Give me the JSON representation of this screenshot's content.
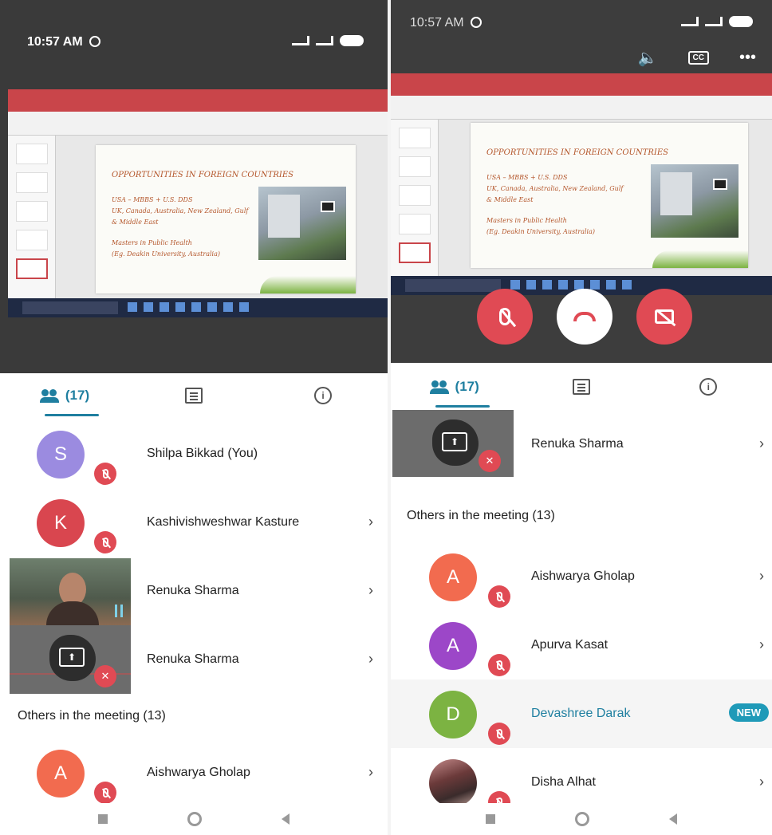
{
  "left": {
    "status": {
      "time": "10:57 AM"
    },
    "slide": {
      "title": "OPPORTUNITIES IN FOREIGN COUNTRIES",
      "lines": [
        "USA – MBBS + U.S. DDS",
        "UK, Canada, Australia, New Zealand, Gulf",
        "& Middle East",
        "Masters in Public Health",
        "(Eg. Deakin University, Australia)"
      ]
    },
    "tabs": {
      "people_count": "(17)"
    },
    "participants": [
      {
        "initial": "S",
        "name": "Shilpa Bikkad (You)",
        "color": "#9b8be0"
      },
      {
        "initial": "K",
        "name": "Kashivishweshwar Kasture",
        "color": "#d9464f"
      },
      {
        "name": "Renuka Sharma"
      },
      {
        "name": "Renuka Sharma"
      }
    ],
    "others_label": "Others in the meeting (13)",
    "others": [
      {
        "initial": "A",
        "name": "Aishwarya Gholap",
        "color": "#f26b4f"
      }
    ]
  },
  "right": {
    "status": {
      "time": "10:57 AM"
    },
    "tabs": {
      "people_count": "(17)"
    },
    "top_participant": {
      "name": "Renuka Sharma"
    },
    "others_label": "Others in the meeting (13)",
    "others": [
      {
        "initial": "A",
        "name": "Aishwarya Gholap",
        "color": "#f26b4f"
      },
      {
        "initial": "A",
        "name": "Apurva Kasat",
        "color": "#9c47c8"
      },
      {
        "initial": "D",
        "name": "Devashree Darak",
        "color": "#7cb342",
        "badge": "NEW"
      },
      {
        "name": "Disha Alhat"
      }
    ]
  },
  "icons": {
    "chevron": "›",
    "speaker": "🔈"
  }
}
